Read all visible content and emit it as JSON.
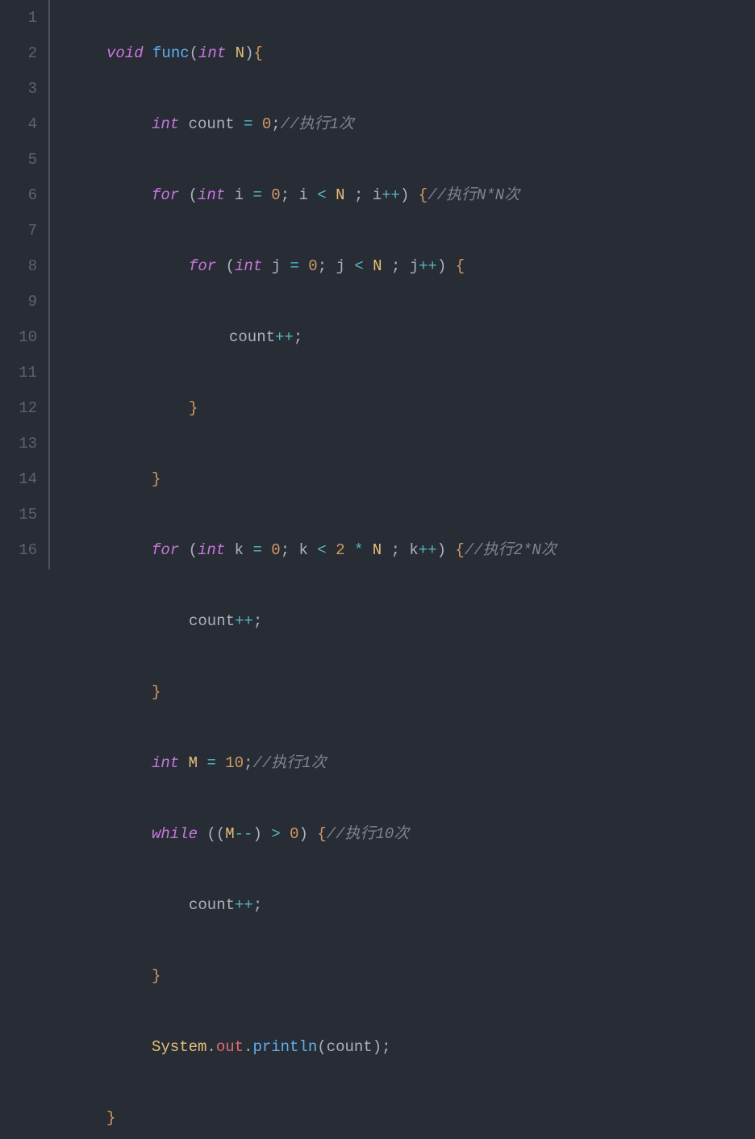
{
  "gutter": {
    "lines": [
      "1",
      "2",
      "3",
      "4",
      "5",
      "6",
      "7",
      "8",
      "9",
      "10",
      "11",
      "12",
      "13",
      "14",
      "15",
      "16"
    ]
  },
  "code": {
    "l1": {
      "kw_void": "void",
      "fn": "func",
      "p_open": "(",
      "type_int": "int",
      "var_N": "N",
      "p_close": ")",
      "brace": "{"
    },
    "l2": {
      "type_int": "int",
      "var": "count",
      "eq": "=",
      "num": "0",
      "semi": ";",
      "comment": "//执行1次"
    },
    "l3": {
      "kw_for": "for",
      "p_open": "(",
      "type_int": "int",
      "var_i": "i",
      "eq": "=",
      "num0": "0",
      "semi1": ";",
      "var_i2": "i",
      "lt": "<",
      "var_N": "N",
      "semi2": ";",
      "var_i3": "i",
      "inc": "++",
      "p_close": ")",
      "brace": "{",
      "comment": "//执行N*N次"
    },
    "l4": {
      "kw_for": "for",
      "p_open": "(",
      "type_int": "int",
      "var_j": "j",
      "eq": "=",
      "num0": "0",
      "semi1": ";",
      "var_j2": "j",
      "lt": "<",
      "var_N": "N",
      "semi2": ";",
      "var_j3": "j",
      "inc": "++",
      "p_close": ")",
      "brace": "{"
    },
    "l5": {
      "var": "count",
      "inc": "++",
      "semi": ";"
    },
    "l6": {
      "brace": "}"
    },
    "l7": {
      "brace": "}"
    },
    "l8": {
      "kw_for": "for",
      "p_open": "(",
      "type_int": "int",
      "var_k": "k",
      "eq": "=",
      "num0": "0",
      "semi1": ";",
      "var_k2": "k",
      "lt": "<",
      "num2": "2",
      "mul": "*",
      "var_N": "N",
      "semi2": ";",
      "var_k3": "k",
      "inc": "++",
      "p_close": ")",
      "brace": "{",
      "comment": "//执行2*N次"
    },
    "l9": {
      "var": "count",
      "inc": "++",
      "semi": ";"
    },
    "l10": {
      "brace": "}"
    },
    "l11": {
      "type_int": "int",
      "var_M": "M",
      "eq": "=",
      "num": "10",
      "semi": ";",
      "comment": "//执行1次"
    },
    "l12": {
      "kw_while": "while",
      "p_open": "(",
      "p_open2": "(",
      "var_M": "M",
      "dec": "--",
      "p_close": ")",
      "gt": ">",
      "num": "0",
      "p_close2": ")",
      "brace": "{",
      "comment": "//执行10次"
    },
    "l13": {
      "var": "count",
      "inc": "++",
      "semi": ";"
    },
    "l14": {
      "brace": "}"
    },
    "l15": {
      "cls": "System",
      "dot1": ".",
      "prop": "out",
      "dot2": ".",
      "fn": "println",
      "p_open": "(",
      "var": "count",
      "p_close": ")",
      "semi": ";"
    },
    "l16": {
      "brace": "}"
    }
  }
}
